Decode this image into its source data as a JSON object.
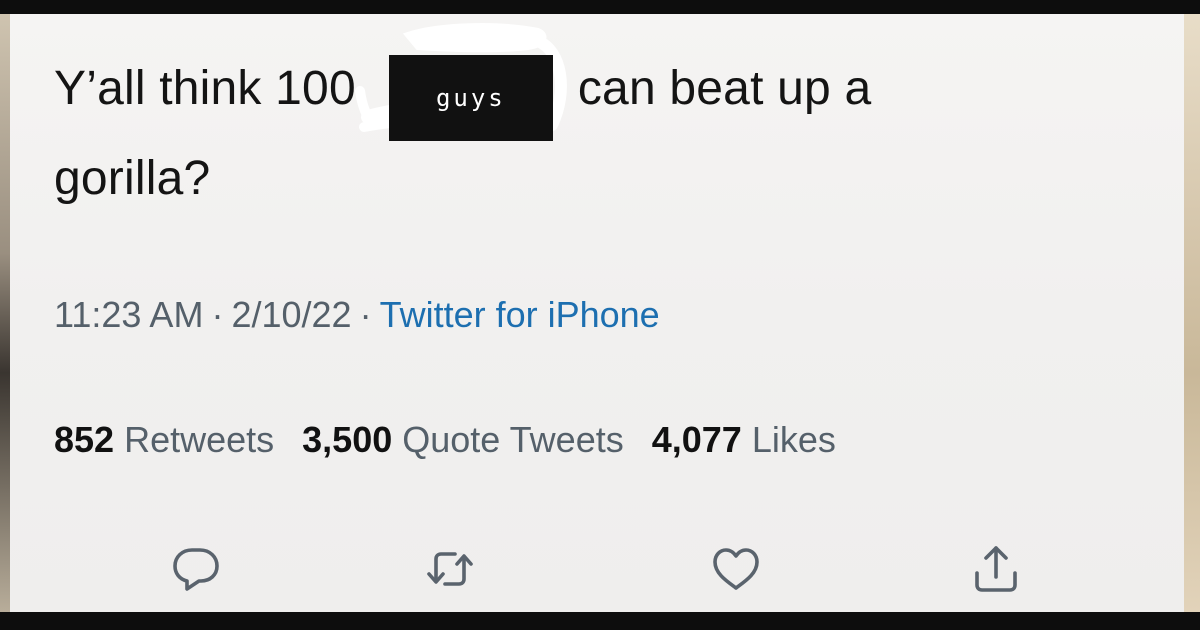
{
  "tweet": {
    "text_line1_before": "Y’all think 100",
    "censor_label": "guys",
    "text_line1_after": "can beat up a",
    "text_line2": "gorilla?"
  },
  "meta": {
    "time": "11:23 AM",
    "separator": "·",
    "date": "2/10/22",
    "source": "Twitter for iPhone"
  },
  "stats": {
    "retweets_count": "852",
    "retweets_label": "Retweets",
    "quotes_count": "3,500",
    "quotes_label": "Quote Tweets",
    "likes_count": "4,077",
    "likes_label": "Likes"
  },
  "actions": [
    {
      "icon": "reply-icon"
    },
    {
      "icon": "retweet-icon"
    },
    {
      "icon": "like-icon"
    },
    {
      "icon": "share-icon"
    }
  ],
  "colors": {
    "text": "#141414",
    "meta_gray": "#55606a",
    "link_blue": "#1d6fb0",
    "icon_gray": "#5a636d"
  }
}
